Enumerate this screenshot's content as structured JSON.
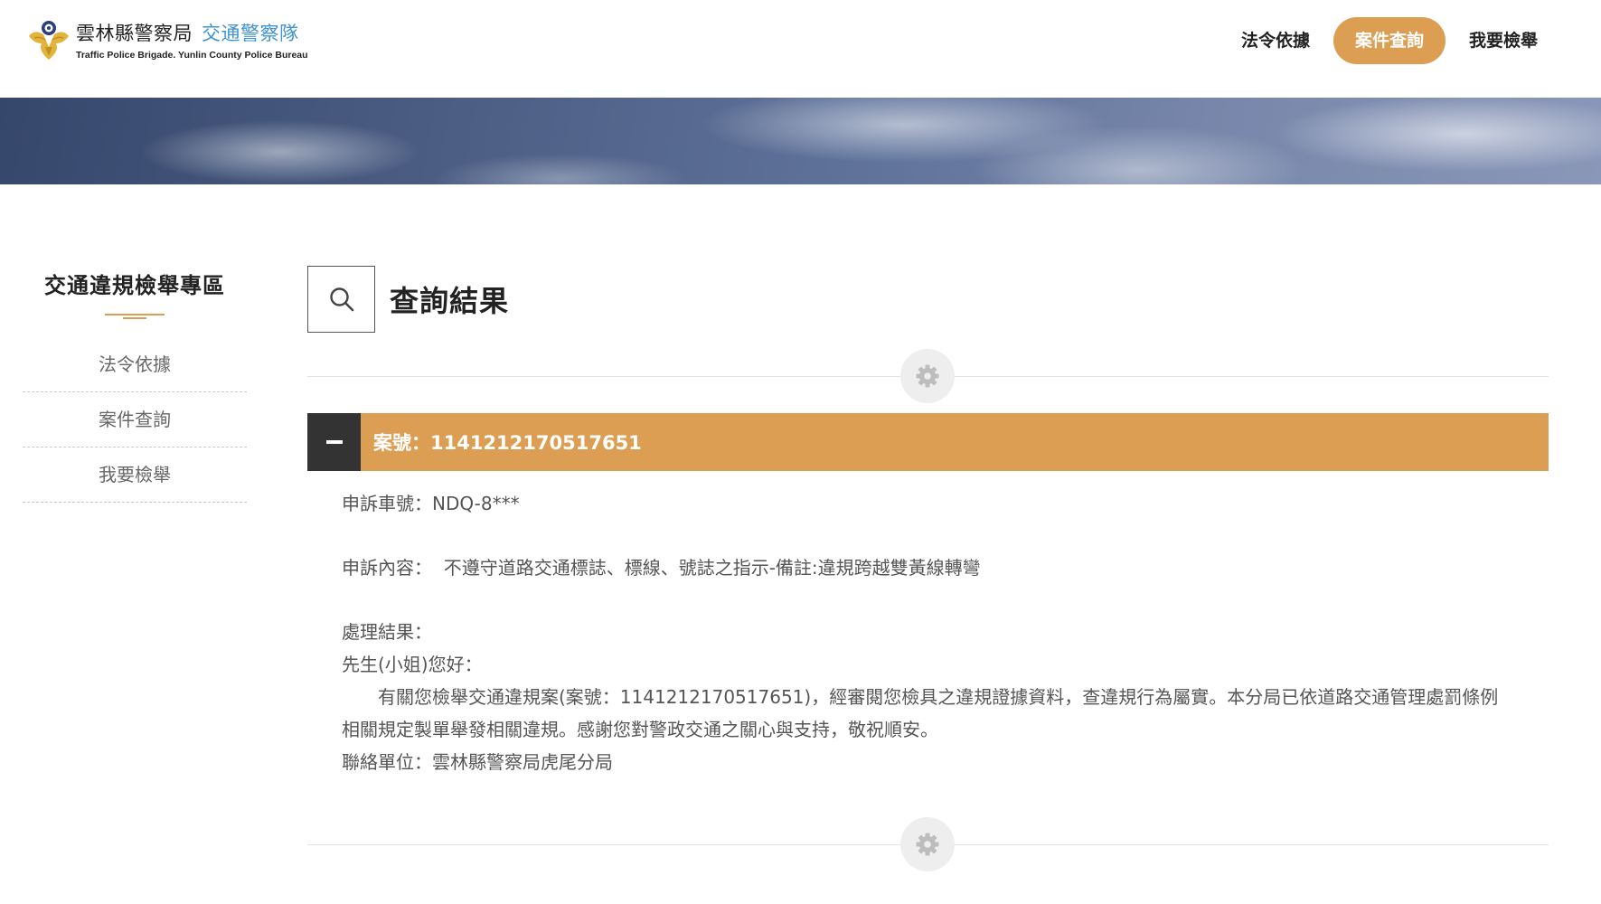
{
  "header": {
    "logo_name": "雲林縣警察局",
    "logo_unit": "交通警察隊",
    "logo_english": "Traffic Police Brigade. Yunlin County Police Bureau",
    "nav": [
      {
        "label": "法令依據",
        "active": false
      },
      {
        "label": "案件查詢",
        "active": true
      },
      {
        "label": "我要檢舉",
        "active": false
      }
    ]
  },
  "sidebar": {
    "title": "交通違規檢舉專區",
    "items": [
      {
        "label": "法令依據"
      },
      {
        "label": "案件查詢"
      },
      {
        "label": "我要檢舉"
      }
    ]
  },
  "main": {
    "title": "查詢結果",
    "case": {
      "number_label": "案號：1141212170517651",
      "plate_label": "申訴車號：",
      "plate_value": "NDQ-8***",
      "content_label": "申訴內容：",
      "content_value": "不遵守道路交通標誌、標線、號誌之指示-備註:違規跨越雙黃線轉彎",
      "result_label": "處理結果：",
      "greeting": "先生(小姐)您好：",
      "reply": "有關您檢舉交通違規案(案號：1141212170517651)，經審閱您檢具之違規證據資料，查違規行為屬實。本分局已依道路交通管理處罰條例相關規定製單舉發相關違規。感謝您對警政交通之關心與支持，敬祝順安。",
      "contact": "聯絡單位：雲林縣警察局虎尾分局"
    }
  },
  "icons": {
    "search": "search-icon",
    "gear": "gear-icon",
    "collapse": "minus-icon"
  },
  "colors": {
    "accent": "#dc9e52",
    "dark": "#333333",
    "brand_blue": "#3f93cf"
  }
}
